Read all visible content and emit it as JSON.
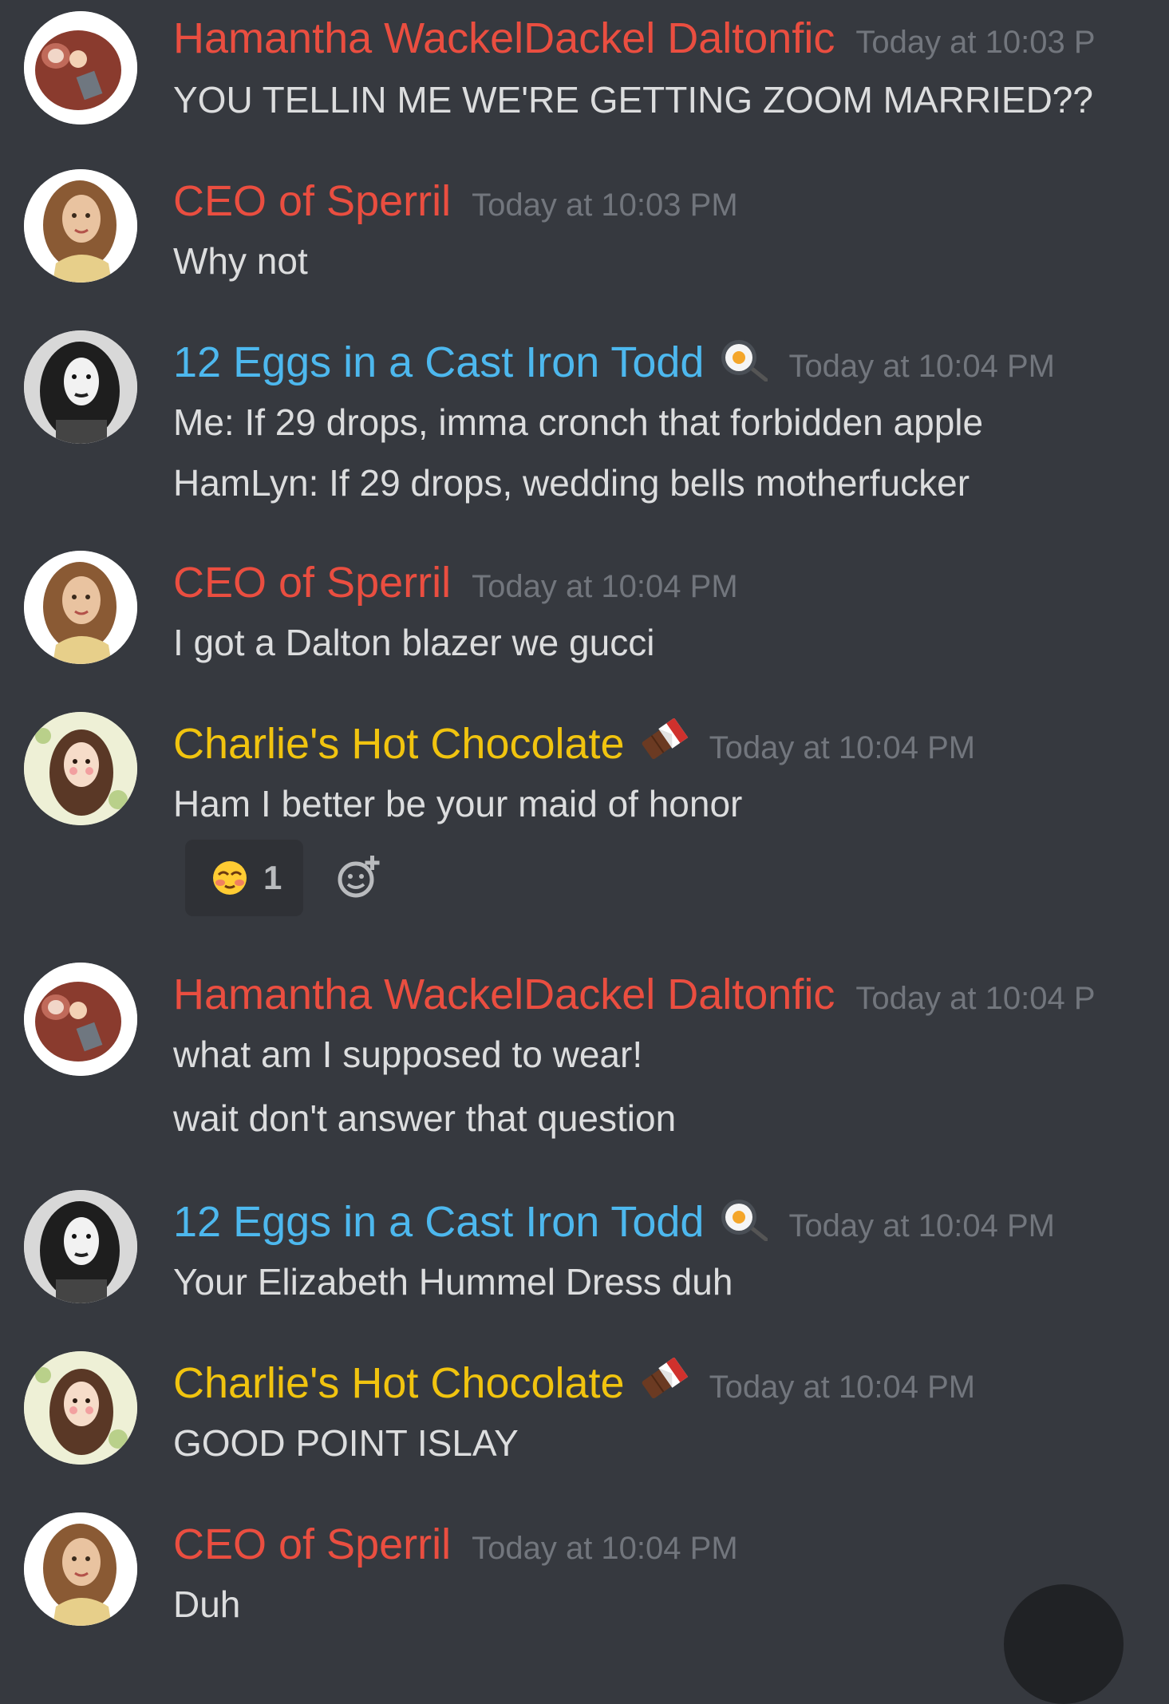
{
  "colors": {
    "background": "#36393f",
    "red_name": "#ea4e40",
    "blue_name": "#4db8ee",
    "yellow_name": "#f1c40f",
    "timestamp": "#72767d",
    "text": "#dcddde"
  },
  "messages": [
    {
      "username": "Hamantha WackelDackel Daltonfic",
      "timestamp": "Today at 10:03 P",
      "avatar": "ham-avatar",
      "lines": [
        "YOU TELLIN ME WE'RE GETTING ZOOM MARRIED??"
      ]
    },
    {
      "username": "CEO of Sperril",
      "timestamp": "Today at 10:03 PM",
      "avatar": "ceo-avatar",
      "lines": [
        "Why not"
      ]
    },
    {
      "username": "12 Eggs in a Cast Iron Todd",
      "role_icon": "fried-egg-pan-icon",
      "timestamp": "Today at 10:04 PM",
      "avatar": "todd-avatar",
      "lines": [
        "Me: If 29 drops, imma cronch that forbidden apple",
        "HamLyn: If 29 drops, wedding bells motherfucker"
      ]
    },
    {
      "username": "CEO of Sperril",
      "timestamp": "Today at 10:04 PM",
      "avatar": "ceo-avatar",
      "lines": [
        "I got a Dalton blazer we gucci"
      ]
    },
    {
      "username": "Charlie's Hot Chocolate",
      "role_icon": "chocolate-bar-icon",
      "timestamp": "Today at 10:04 PM",
      "avatar": "charlie-avatar",
      "lines": [
        "Ham I better be your maid of honor"
      ],
      "reaction": {
        "emoji": "blushing-face-icon",
        "count": "1"
      }
    },
    {
      "username": "Hamantha WackelDackel Daltonfic",
      "timestamp": "Today at 10:04 P",
      "avatar": "ham-avatar",
      "lines": [
        "what am I supposed to wear!",
        "wait don't answer that question"
      ]
    },
    {
      "username": "12 Eggs in a Cast Iron Todd",
      "role_icon": "fried-egg-pan-icon",
      "timestamp": "Today at 10:04 PM",
      "avatar": "todd-avatar",
      "lines": [
        "Your Elizabeth Hummel Dress duh"
      ]
    },
    {
      "username": "Charlie's Hot Chocolate",
      "role_icon": "chocolate-bar-icon",
      "timestamp": "Today at 10:04 PM",
      "avatar": "charlie-avatar",
      "lines": [
        "GOOD POINT ISLAY"
      ]
    },
    {
      "username": "CEO of Sperril",
      "timestamp": "Today at 10:04 PM",
      "avatar": "ceo-avatar",
      "lines": [
        "Duh"
      ]
    }
  ]
}
